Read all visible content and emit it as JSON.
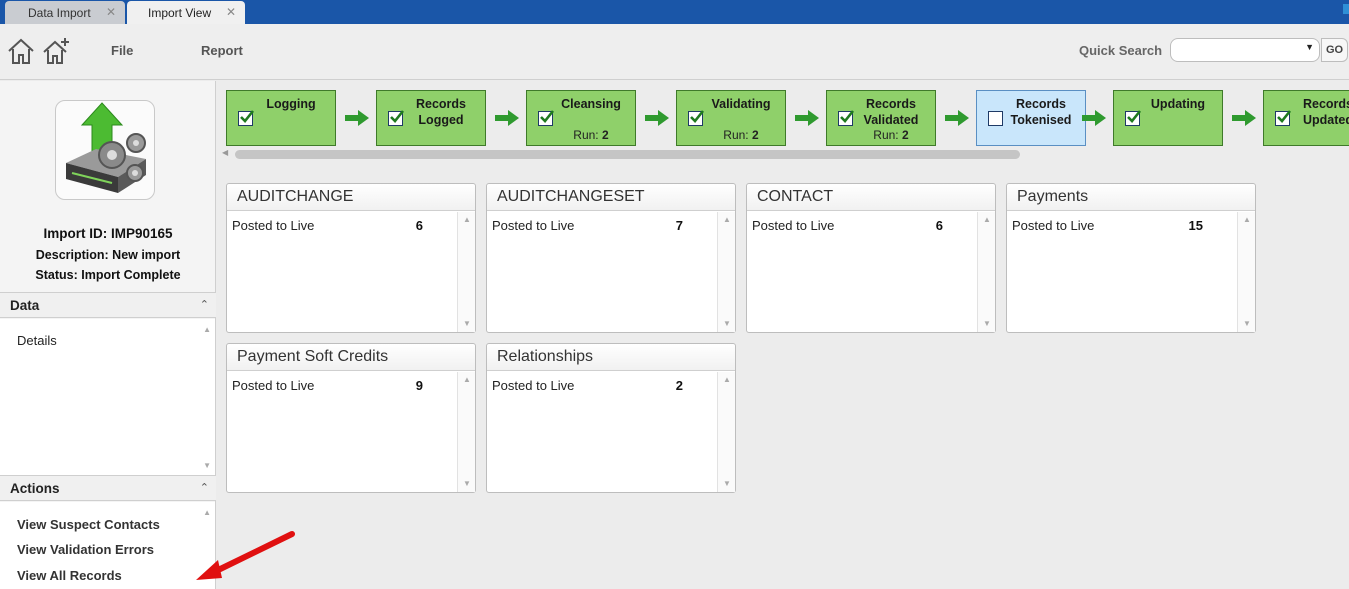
{
  "tabs": [
    {
      "label": "Data Import"
    },
    {
      "label": "Import View"
    }
  ],
  "toolbar": {
    "menu": [
      "File",
      "Report"
    ],
    "quick_search_label": "Quick Search",
    "quick_search_value": "",
    "go_label": "GO"
  },
  "import": {
    "id_text": "Import ID: IMP90165",
    "description_text": "Description: New import",
    "status_text": "Status: Import Complete"
  },
  "data_section": {
    "title": "Data",
    "items": [
      "Details"
    ]
  },
  "actions_section": {
    "title": "Actions",
    "items": [
      "View Suspect Contacts",
      "View Validation Errors",
      "View All Records"
    ]
  },
  "workflow": [
    {
      "name": "Logging",
      "run_label": "",
      "run_value": "",
      "checked": true,
      "current": false
    },
    {
      "name": "Records Logged",
      "run_label": "",
      "run_value": "",
      "checked": true,
      "current": false
    },
    {
      "name": "Cleansing",
      "run_label": "Run:",
      "run_value": "2",
      "checked": true,
      "current": false
    },
    {
      "name": "Validating",
      "run_label": "Run:",
      "run_value": "2",
      "checked": true,
      "current": false
    },
    {
      "name": "Records Validated",
      "run_label": "Run:",
      "run_value": "2",
      "checked": true,
      "current": false
    },
    {
      "name": "Records Tokenised",
      "run_label": "",
      "run_value": "",
      "checked": false,
      "current": true
    },
    {
      "name": "Updating",
      "run_label": "",
      "run_value": "",
      "checked": true,
      "current": false
    },
    {
      "name": "Records Updated",
      "run_label": "",
      "run_value": "",
      "checked": true,
      "current": false
    }
  ],
  "cards": [
    {
      "title": "AUDITCHANGE",
      "label": "Posted to Live",
      "value": "6"
    },
    {
      "title": "AUDITCHANGESET",
      "label": "Posted to Live",
      "value": "7"
    },
    {
      "title": "CONTACT",
      "label": "Posted to Live",
      "value": "6"
    },
    {
      "title": "Payments",
      "label": "Posted to Live",
      "value": "15"
    },
    {
      "title": "Payment Soft Credits",
      "label": "Posted to Live",
      "value": "9"
    },
    {
      "title": "Relationships",
      "label": "Posted to Live",
      "value": "2"
    }
  ],
  "colors": {
    "tabbar": "#1a56a8",
    "step_done": "#8fd06a",
    "step_current": "#c9e6fb",
    "arrow": "#2f9a2f",
    "annotation_arrow": "#e01010"
  },
  "icons": [
    "home-icon",
    "add-home-icon",
    "dropdown-caret-icon",
    "import-drive-icon",
    "checkbox-icon",
    "step-arrow-icon",
    "annotation-arrow-icon"
  ]
}
